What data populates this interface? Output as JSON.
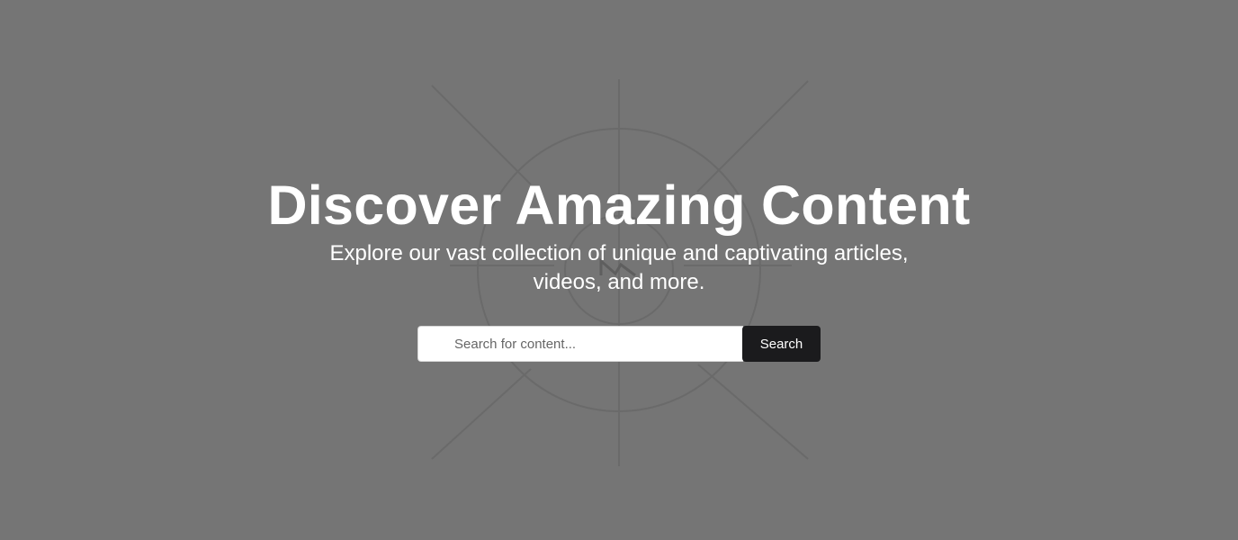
{
  "hero": {
    "title": "Discover Amazing Content",
    "subtitle": "Explore our vast collection of unique and captivating articles, videos, and more.",
    "background_color": "#757575",
    "background_icon": "camera-aperture-icon"
  },
  "search": {
    "placeholder": "Search for content...",
    "value": "",
    "button_label": "Search",
    "button_color": "#1b1b1d"
  }
}
